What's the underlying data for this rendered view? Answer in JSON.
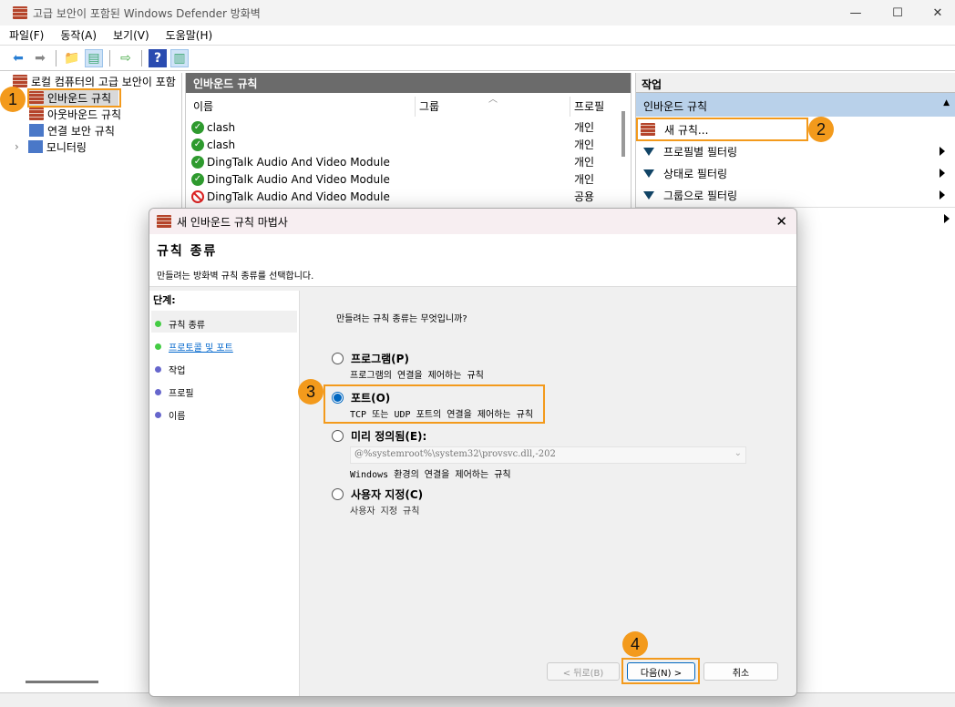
{
  "window": {
    "title": "고급 보안이 포함된 Windows Defender 방화벽",
    "minimize": "—",
    "maximize": "☐",
    "close": "✕"
  },
  "menu": [
    "파일(F)",
    "동작(A)",
    "보기(V)",
    "도움말(H)"
  ],
  "tree": {
    "root": "로컬 컴퓨터의 고급 보안이 포함",
    "items": [
      "인바운드 규칙",
      "아웃바운드 규칙",
      "연결 보안 규칙",
      "모니터링"
    ]
  },
  "middle": {
    "title": "인바운드 규칙",
    "columns": [
      "이름",
      "그룹",
      "프로필"
    ],
    "rows": [
      {
        "name": "clash",
        "profile": "개인",
        "status": "allow"
      },
      {
        "name": "clash",
        "profile": "개인",
        "status": "allow"
      },
      {
        "name": "DingTalk Audio And Video Module",
        "profile": "개인",
        "status": "allow"
      },
      {
        "name": "DingTalk Audio And Video Module",
        "profile": "개인",
        "status": "allow"
      },
      {
        "name": "DingTalk Audio And Video Module",
        "profile": "공용",
        "status": "block"
      }
    ]
  },
  "actions": {
    "title": "작업",
    "section": "인바운드 규칙",
    "items": [
      "새 규칙...",
      "프로필별 필터링",
      "상태로 필터링",
      "그룹으로 필터링"
    ]
  },
  "dialog": {
    "title": "새 인바운드 규칙 마법사",
    "heading": "규칙 종류",
    "subheading": "만들려는 방화벽 규칙 종류를 선택합니다.",
    "steps_label": "단계:",
    "steps": [
      "규칙 종류",
      "프로토콜 및 포트",
      "작업",
      "프로필",
      "이름"
    ],
    "question": "만들려는 규칙 종류는 무엇입니까?",
    "options": [
      {
        "label": "프로그램(P)",
        "desc": "프로그램의 연결을 제어하는 규칙",
        "selected": false
      },
      {
        "label": "포트(O)",
        "desc": "TCP 또는 UDP 포트의 연결을 제어하는 규칙",
        "selected": true
      },
      {
        "label": "미리 정의됨(E):",
        "desc": "Windows 환경의 연결을 제어하는 규칙",
        "selected": false
      },
      {
        "label": "사용자 지정(C)",
        "desc": "사용자 지정 규칙",
        "selected": false
      }
    ],
    "predefined_value": "@%systemroot%\\system32\\provsvc.dll,-202",
    "back": "< 뒤로(B)",
    "next": "다음(N) >",
    "cancel": "취소"
  },
  "annotations": [
    "1",
    "2",
    "3",
    "4"
  ],
  "colors": {
    "accent": "#f39a1c",
    "selected": "#0067c0"
  }
}
